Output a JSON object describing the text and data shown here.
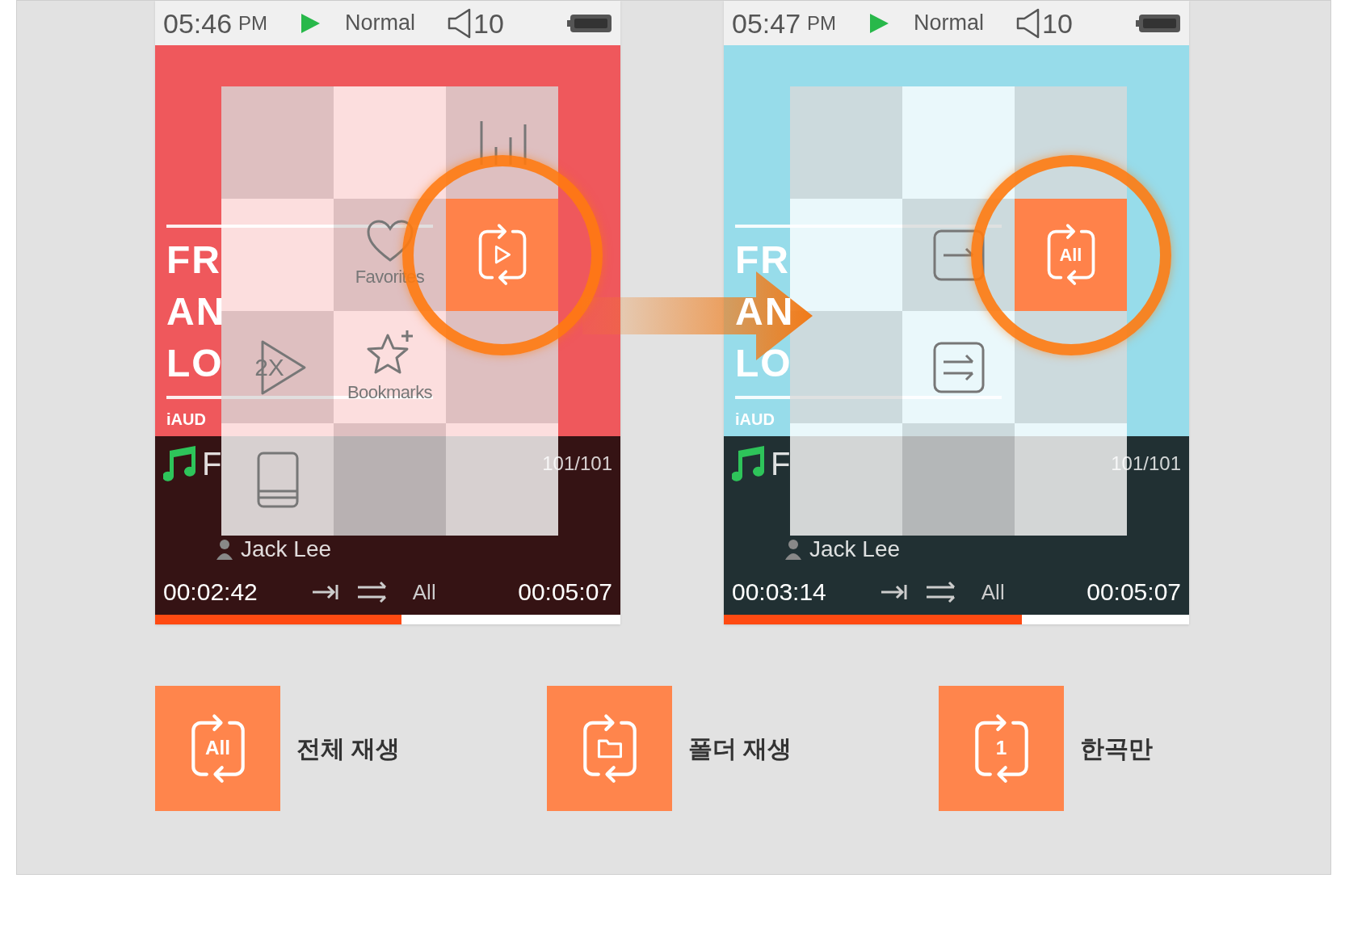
{
  "screens": [
    {
      "color": "#ef585c",
      "status": {
        "time": "05:46",
        "ampm": "PM",
        "mode": "Normal",
        "volume": "10"
      },
      "album_title": [
        "FR",
        "AN",
        "LO"
      ],
      "album_credit": "iAUD",
      "track": {
        "title": "F",
        "count": "101/101",
        "artist": "Jack Lee"
      },
      "elapsed": "00:02:42",
      "total": "00:05:07",
      "repeat_label": "All",
      "level": 0.53,
      "menu": [
        {
          "kind": "blank",
          "selected": false
        },
        {
          "kind": "blank",
          "selected": false
        },
        {
          "kind": "equalizer",
          "selected": false
        },
        {
          "kind": "blank",
          "selected": false
        },
        {
          "kind": "favorites",
          "label": "Favorites",
          "selected": false
        },
        {
          "kind": "repeat-play",
          "selected": true
        },
        {
          "kind": "speed",
          "label": "2X",
          "selected": false
        },
        {
          "kind": "bookmarks",
          "label": "Bookmarks",
          "selected": false
        },
        {
          "kind": "blank",
          "selected": false
        },
        {
          "kind": "book",
          "selected": false
        },
        {
          "kind": "blank",
          "selected": false
        },
        {
          "kind": "blank",
          "selected": false
        }
      ]
    },
    {
      "color": "#97dcea",
      "status": {
        "time": "05:47",
        "ampm": "PM",
        "mode": "Normal",
        "volume": "10"
      },
      "album_title": [
        "FR",
        "AN",
        "LO"
      ],
      "album_credit": "iAUD",
      "track": {
        "title": "F",
        "count": "101/101",
        "artist": "Jack Lee"
      },
      "elapsed": "00:03:14",
      "total": "00:05:07",
      "repeat_label": "All",
      "level": 0.64,
      "menu": [
        {
          "kind": "blank",
          "selected": false
        },
        {
          "kind": "blank",
          "selected": false
        },
        {
          "kind": "blank",
          "selected": false
        },
        {
          "kind": "blank",
          "selected": false
        },
        {
          "kind": "single",
          "selected": false
        },
        {
          "kind": "repeat-all",
          "label": "All",
          "selected": true
        },
        {
          "kind": "blank",
          "selected": false
        },
        {
          "kind": "shuffle",
          "selected": false
        },
        {
          "kind": "blank",
          "selected": false
        },
        {
          "kind": "blank",
          "selected": false
        },
        {
          "kind": "blank",
          "selected": false
        },
        {
          "kind": "blank",
          "selected": false
        }
      ]
    }
  ],
  "legend": [
    {
      "kind": "all",
      "icon_text": "All",
      "label": "전체 재생"
    },
    {
      "kind": "folder",
      "label": "폴더 재생"
    },
    {
      "kind": "one",
      "icon_text": "1",
      "label": "한곡만"
    }
  ]
}
